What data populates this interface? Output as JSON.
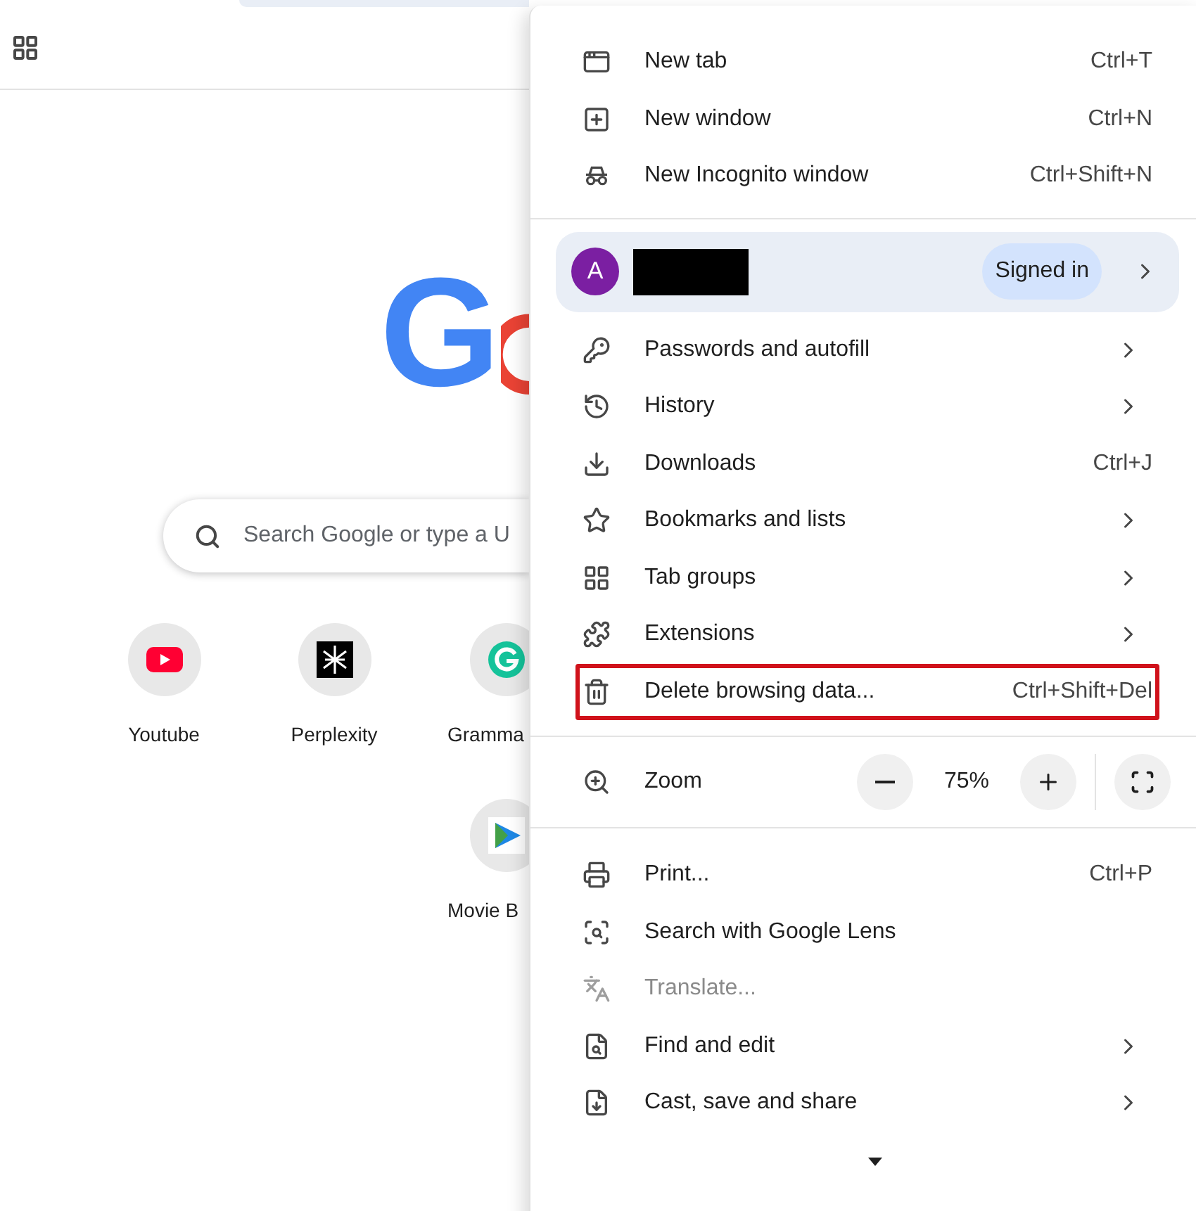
{
  "page": {
    "logo": "G",
    "search": {
      "placeholder": "Search Google or type a U"
    },
    "shortcuts": [
      {
        "label": "Youtube"
      },
      {
        "label": "Perplexity"
      },
      {
        "label": "Gramma"
      },
      {
        "label": "Movie B"
      }
    ]
  },
  "menu": {
    "sections": [
      {
        "kind": "items",
        "items": [
          {
            "label": "New tab",
            "shortcut": "Ctrl+T",
            "submenu": false,
            "disabled": false,
            "highlighted": false
          },
          {
            "label": "New window",
            "shortcut": "Ctrl+N",
            "submenu": false,
            "disabled": false,
            "highlighted": false
          },
          {
            "label": "New Incognito window",
            "shortcut": "Ctrl+Shift+N",
            "submenu": false,
            "disabled": false,
            "highlighted": false
          }
        ]
      },
      {
        "kind": "profile",
        "avatar": "A",
        "name_redacted": true,
        "status": "Signed in"
      },
      {
        "kind": "items",
        "items": [
          {
            "label": "Passwords and autofill",
            "submenu": true,
            "disabled": false,
            "highlighted": false
          },
          {
            "label": "History",
            "submenu": true,
            "disabled": false,
            "highlighted": false
          },
          {
            "label": "Downloads",
            "shortcut": "Ctrl+J",
            "submenu": false,
            "disabled": false,
            "highlighted": false
          },
          {
            "label": "Bookmarks and lists",
            "submenu": true,
            "disabled": false,
            "highlighted": false
          },
          {
            "label": "Tab groups",
            "submenu": true,
            "disabled": false,
            "highlighted": false
          },
          {
            "label": "Extensions",
            "submenu": true,
            "disabled": false,
            "highlighted": false
          },
          {
            "label": "Delete browsing data...",
            "shortcut": "Ctrl+Shift+Del",
            "submenu": false,
            "disabled": false,
            "highlighted": true
          }
        ]
      },
      {
        "kind": "zoom",
        "label": "Zoom",
        "value": "75%"
      },
      {
        "kind": "items",
        "items": [
          {
            "label": "Print...",
            "shortcut": "Ctrl+P",
            "submenu": false,
            "disabled": false,
            "highlighted": false
          },
          {
            "label": "Search with Google Lens",
            "submenu": false,
            "disabled": false,
            "highlighted": false
          },
          {
            "label": "Translate...",
            "submenu": false,
            "disabled": true,
            "highlighted": false
          },
          {
            "label": "Find and edit",
            "submenu": true,
            "disabled": false,
            "highlighted": false
          },
          {
            "label": "Cast, save and share",
            "submenu": true,
            "disabled": false,
            "highlighted": false
          }
        ]
      }
    ]
  }
}
